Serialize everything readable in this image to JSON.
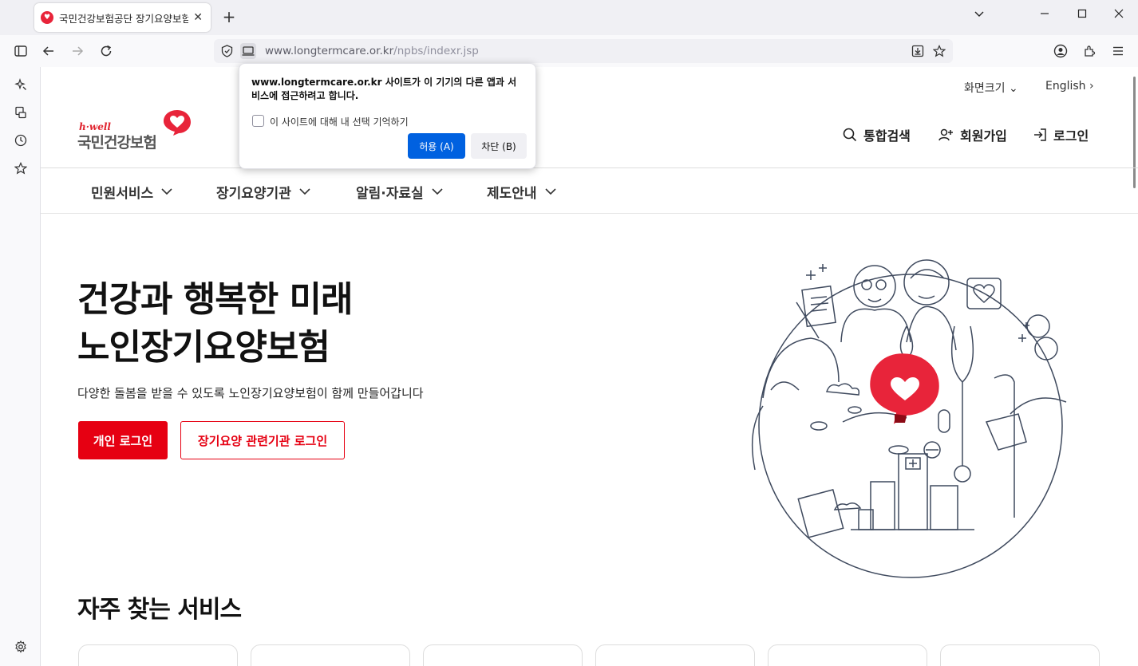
{
  "browser": {
    "tab_title": "국민건강보험공단 장기요양보험",
    "url_domain": "www.longtermcare.or.kr",
    "url_path": "/npbs/indexr.jsp"
  },
  "popup": {
    "message": "www.longtermcare.or.kr 사이트가 이 기기의 다른 앱과 서비스에 접근하려고 합니다.",
    "checkbox_label": "이 사이트에 대해 내 선택 기억하기",
    "allow_label": "허용 (A)",
    "block_label": "차단 (B)"
  },
  "header": {
    "logo_small": "h·well",
    "logo_name": "국민건강보험",
    "screen_size": "화면크기",
    "english": "English",
    "search": "통합검색",
    "signup": "회원가입",
    "login": "로그인"
  },
  "gnb": {
    "items": [
      {
        "label": "민원서비스"
      },
      {
        "label": "장기요양기관"
      },
      {
        "label": "알림·자료실"
      },
      {
        "label": "제도안내"
      }
    ]
  },
  "hero": {
    "title_line1": "건강과 행복한 미래",
    "title_line2": "노인장기요양보험",
    "subtitle": "다양한 돌봄을 받을 수 있도록 노인장기요양보험이 함께 만들어갑니다",
    "personal_login": "개인 로그인",
    "org_login": "장기요양 관련기관 로그인"
  },
  "services": {
    "title": "자주 찾는 서비스"
  },
  "colors": {
    "brand_red": "#e60012",
    "allow_blue": "#0061e0"
  }
}
